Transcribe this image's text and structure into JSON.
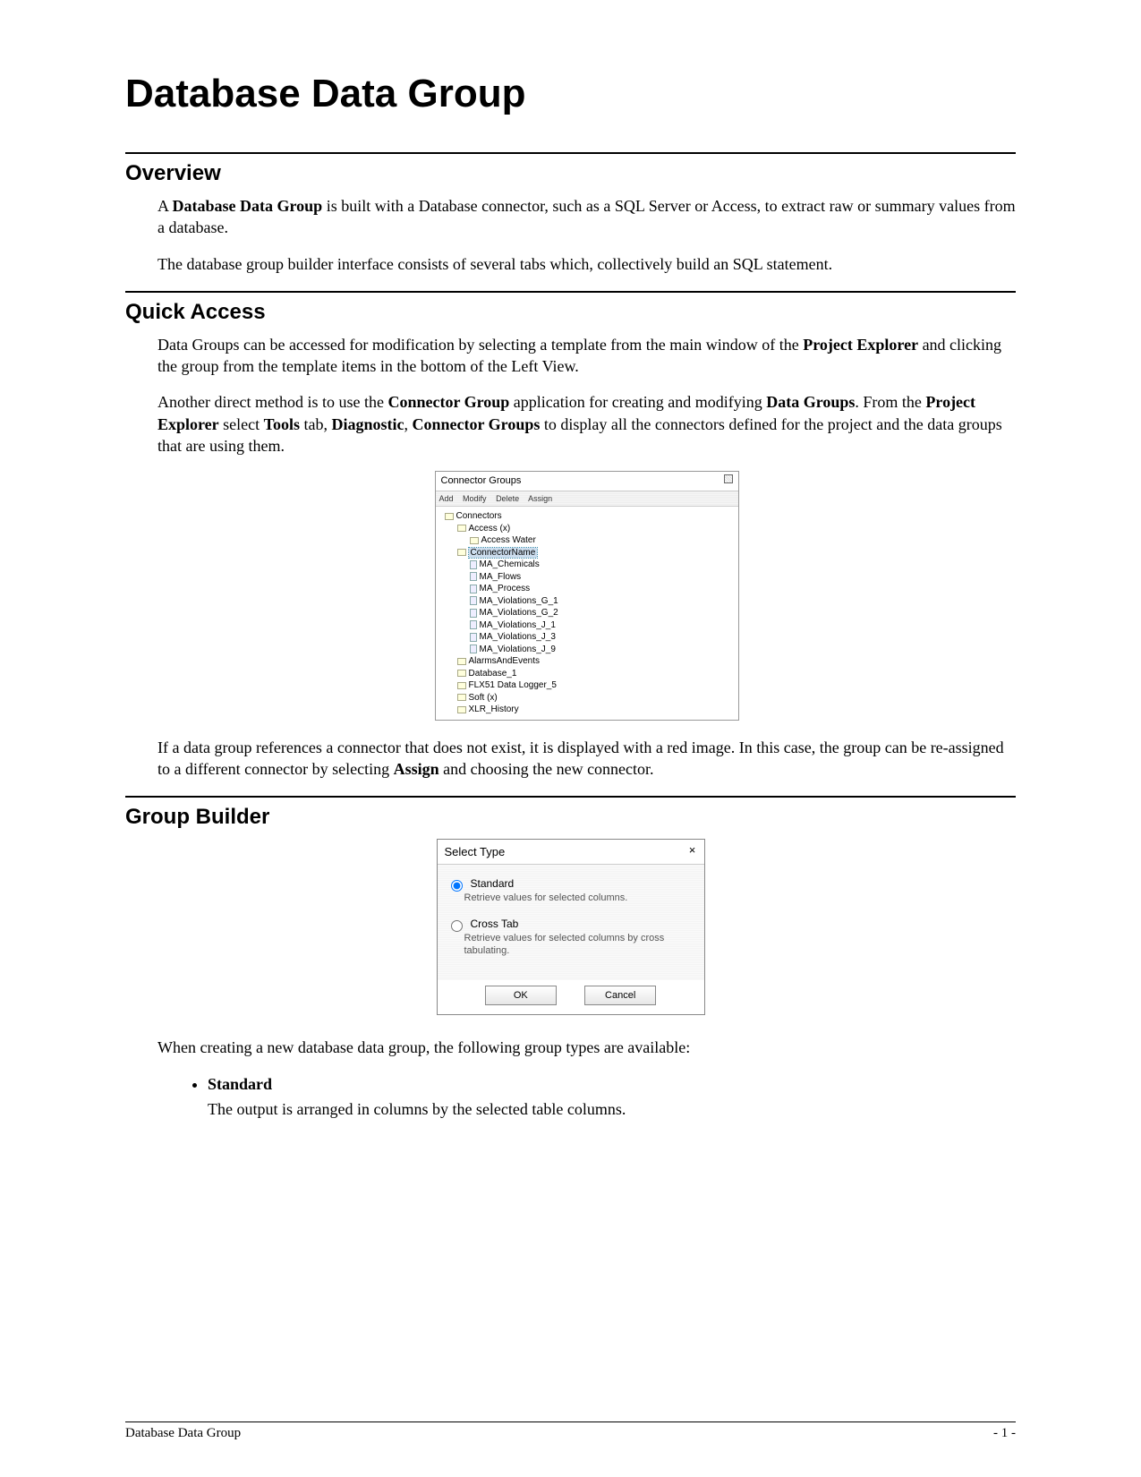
{
  "title": "Database Data Group",
  "sections": {
    "overview": {
      "heading": "Overview",
      "p1_pre": "A ",
      "p1_bold": "Database Data Group ",
      "p1_post": "is built with a Database connector, such as a SQL Server or Access, to extract raw or summary values from a database.",
      "p2": "The database group builder interface consists of several tabs which, collectively build an SQL statement."
    },
    "quick_access": {
      "heading": "Quick Access",
      "p1_pre": "Data Groups can be accessed for modification by selecting a template from the main window of the ",
      "p1_bold": "Project Explorer",
      "p1_post": " and clicking the group from the template items in the bottom of the Left View.",
      "p2_a": "Another direct method is to use the ",
      "p2_b1": "Connector Group",
      "p2_c": " application for creating and modifying ",
      "p2_b2": "Data Groups",
      "p2_d": ".  From the ",
      "p2_b3": "Project Explorer",
      "p2_e": " select ",
      "p2_b4": "Tools",
      "p2_f": " tab, ",
      "p2_b5": "Diagnostic",
      "p2_g": ", ",
      "p2_b6": "Connector Groups",
      "p2_h": " to display all the connectors defined for the project and the data groups that are using them.",
      "p3_a": "If a data group references a connector that does not exist, it is displayed with a red image.  In this case, the group can be re-assigned to a different connector by selecting ",
      "p3_b": "Assign",
      "p3_c": " and choosing the new connector."
    },
    "group_builder": {
      "heading": "Group Builder",
      "intro": "When creating a new database data group, the following group types are available:",
      "bullets": [
        {
          "lead": "Standard",
          "expl": "The output is arranged in columns by the selected table columns."
        }
      ]
    }
  },
  "connector_groups_window": {
    "title": "Connector Groups",
    "toolbar": [
      "Add",
      "Modify",
      "Delete",
      "Assign"
    ],
    "tree": [
      {
        "level": 1,
        "icon": "folder",
        "label": "Connectors"
      },
      {
        "level": 2,
        "icon": "folder",
        "label": "Access (x)"
      },
      {
        "level": 3,
        "icon": "folder",
        "label": "Access Water"
      },
      {
        "level": 2,
        "icon": "folder",
        "label": "ConnectorName",
        "highlight": true
      },
      {
        "level": 3,
        "icon": "file",
        "label": "MA_Chemicals"
      },
      {
        "level": 3,
        "icon": "file",
        "label": "MA_Flows"
      },
      {
        "level": 3,
        "icon": "file",
        "label": "MA_Process"
      },
      {
        "level": 3,
        "icon": "file",
        "label": "MA_Violations_G_1"
      },
      {
        "level": 3,
        "icon": "file",
        "label": "MA_Violations_G_2"
      },
      {
        "level": 3,
        "icon": "file",
        "label": "MA_Violations_J_1"
      },
      {
        "level": 3,
        "icon": "file",
        "label": "MA_Violations_J_3"
      },
      {
        "level": 3,
        "icon": "file",
        "label": "MA_Violations_J_9"
      },
      {
        "level": 2,
        "icon": "folder",
        "label": "AlarmsAndEvents"
      },
      {
        "level": 2,
        "icon": "folder",
        "label": "Database_1"
      },
      {
        "level": 2,
        "icon": "folder",
        "label": "FLX51 Data Logger_5"
      },
      {
        "level": 2,
        "icon": "folder",
        "label": "Soft (x)"
      },
      {
        "level": 2,
        "icon": "folder",
        "label": "XLR_History"
      }
    ]
  },
  "select_type_dialog": {
    "title": "Select Type",
    "options": [
      {
        "label": "Standard",
        "desc": "Retrieve values for selected columns.",
        "checked": true
      },
      {
        "label": "Cross Tab",
        "desc": "Retrieve values for selected columns by cross tabulating.",
        "checked": false
      }
    ],
    "ok": "OK",
    "cancel": "Cancel"
  },
  "footer": {
    "left": "Database Data Group",
    "right": "- 1 -"
  }
}
